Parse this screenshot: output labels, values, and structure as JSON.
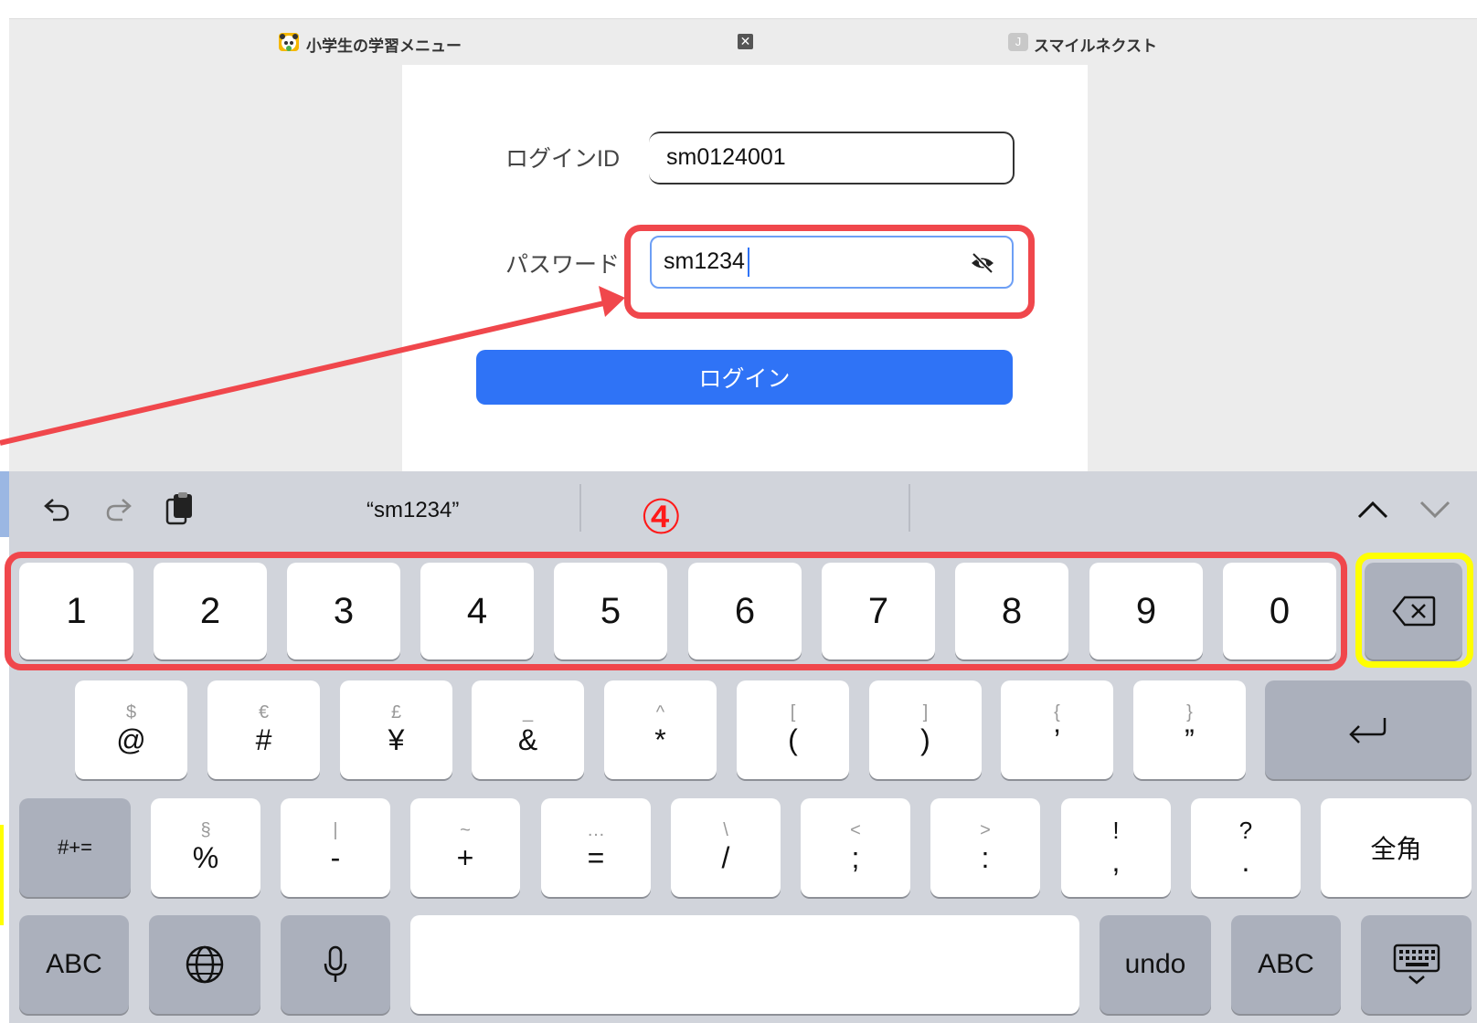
{
  "tabs": [
    {
      "title": "小学生の学習メニュー",
      "icon": "panda-favicon-icon"
    },
    {
      "title": "スマイルネクスト",
      "icon": "letter-j-favicon-icon"
    }
  ],
  "form": {
    "login_id_label": "ログインID",
    "login_id_value": "sm0124001",
    "password_label": "パスワード",
    "password_value": "sm1234",
    "login_button": "ログイン"
  },
  "keyboard": {
    "suggestion": "“sm1234”",
    "annotation_number": "④",
    "number_row": [
      "1",
      "2",
      "3",
      "4",
      "5",
      "6",
      "7",
      "8",
      "9",
      "0"
    ],
    "symbol_row": [
      {
        "alt": "$",
        "main": "@"
      },
      {
        "alt": "€",
        "main": "#"
      },
      {
        "alt": "£",
        "main": "¥"
      },
      {
        "alt": "_",
        "main": "&"
      },
      {
        "alt": "^",
        "main": "*"
      },
      {
        "alt": "[",
        "main": "("
      },
      {
        "alt": "]",
        "main": ")"
      },
      {
        "alt": "{",
        "main": "’"
      },
      {
        "alt": "}",
        "main": "”"
      }
    ],
    "punct_row": [
      {
        "alt": "§",
        "main": "%"
      },
      {
        "alt": "|",
        "main": "-"
      },
      {
        "alt": "~",
        "main": "+"
      },
      {
        "alt": "…",
        "main": "="
      },
      {
        "alt": "\\",
        "main": "/"
      },
      {
        "alt": "<",
        "main": ";"
      },
      {
        "alt": ">",
        "main": ":"
      },
      {
        "alt": "!",
        "main": ","
      },
      {
        "alt": "?",
        "main": "."
      }
    ],
    "shift_label": "#+=",
    "zenkaku_label": "全角",
    "abc_left": "ABC",
    "undo_label": "undo",
    "abc_right": "ABC"
  },
  "colors": {
    "accent_blue": "#2f73f6",
    "annotation_red": "#f0474c",
    "annotation_yellow": "#ffff00"
  }
}
